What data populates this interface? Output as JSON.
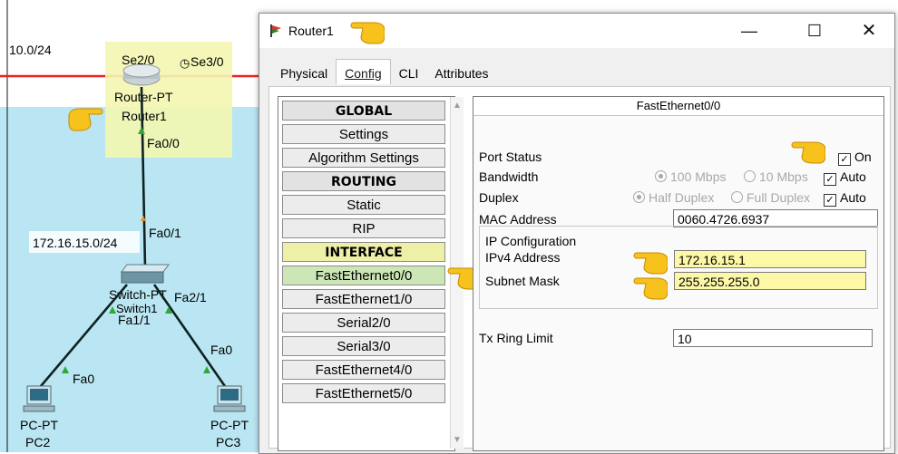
{
  "topology": {
    "network_top": "10.0/24",
    "network_mid": "172.16.15.0/24",
    "router": {
      "port_se2": "Se2/0",
      "port_se3": "Se3/0",
      "model": "Router-PT",
      "name": "Router1",
      "port_fa00": "Fa0/0"
    },
    "switch": {
      "port_fa01": "Fa0/1",
      "port_fa21": "Fa2/1",
      "port_fa11": "Fa1/1",
      "label": "Switch-PT",
      "name": "Switch1"
    },
    "pc2": {
      "model": "PC-PT",
      "name": "PC2",
      "port": "Fa0"
    },
    "pc3": {
      "model": "PC-PT",
      "name": "PC3",
      "port": "Fa0"
    }
  },
  "window": {
    "title": "Router1",
    "controls": {
      "minimize": "—",
      "maximize": "☐",
      "close": "✕"
    }
  },
  "tabs": [
    "Physical",
    "Config",
    "CLI",
    "Attributes"
  ],
  "active_tab": "Config",
  "nav": {
    "items": [
      {
        "label": "GLOBAL",
        "type": "header"
      },
      {
        "label": "Settings",
        "type": "item"
      },
      {
        "label": "Algorithm Settings",
        "type": "item"
      },
      {
        "label": "ROUTING",
        "type": "header"
      },
      {
        "label": "Static",
        "type": "item"
      },
      {
        "label": "RIP",
        "type": "item"
      },
      {
        "label": "INTERFACE",
        "type": "iface-header"
      },
      {
        "label": "FastEthernet0/0",
        "type": "selected"
      },
      {
        "label": "FastEthernet1/0",
        "type": "item"
      },
      {
        "label": "Serial2/0",
        "type": "item"
      },
      {
        "label": "Serial3/0",
        "type": "item"
      },
      {
        "label": "FastEthernet4/0",
        "type": "item"
      },
      {
        "label": "FastEthernet5/0",
        "type": "item"
      }
    ]
  },
  "panel": {
    "title": "FastEthernet0/0",
    "port_status": {
      "label": "Port Status",
      "on_label": "On",
      "checked": true
    },
    "bandwidth": {
      "label": "Bandwidth",
      "opt1": "100 Mbps",
      "opt2": "10 Mbps",
      "auto": "Auto",
      "auto_checked": true
    },
    "duplex": {
      "label": "Duplex",
      "opt1": "Half Duplex",
      "opt2": "Full Duplex",
      "auto": "Auto",
      "auto_checked": true
    },
    "mac": {
      "label": "MAC Address",
      "value": "0060.4726.6937"
    },
    "ip_config": {
      "heading": "IP Configuration",
      "ipv4_label": "IPv4 Address",
      "ipv4_value": "172.16.15.1",
      "mask_label": "Subnet Mask",
      "mask_value": "255.255.255.0"
    },
    "tx_ring": {
      "label": "Tx Ring Limit",
      "value": "10"
    }
  },
  "colors": {
    "workspace_bg": "#b9e6f2",
    "serial_link": "#e8231f",
    "router_highlight": "#f3f6b0",
    "nav_selected": "#cde6b5",
    "nav_interface_header": "#eef0a8",
    "field_highlight": "#fdf7a8",
    "pointer_hand": "#f8c21c"
  }
}
